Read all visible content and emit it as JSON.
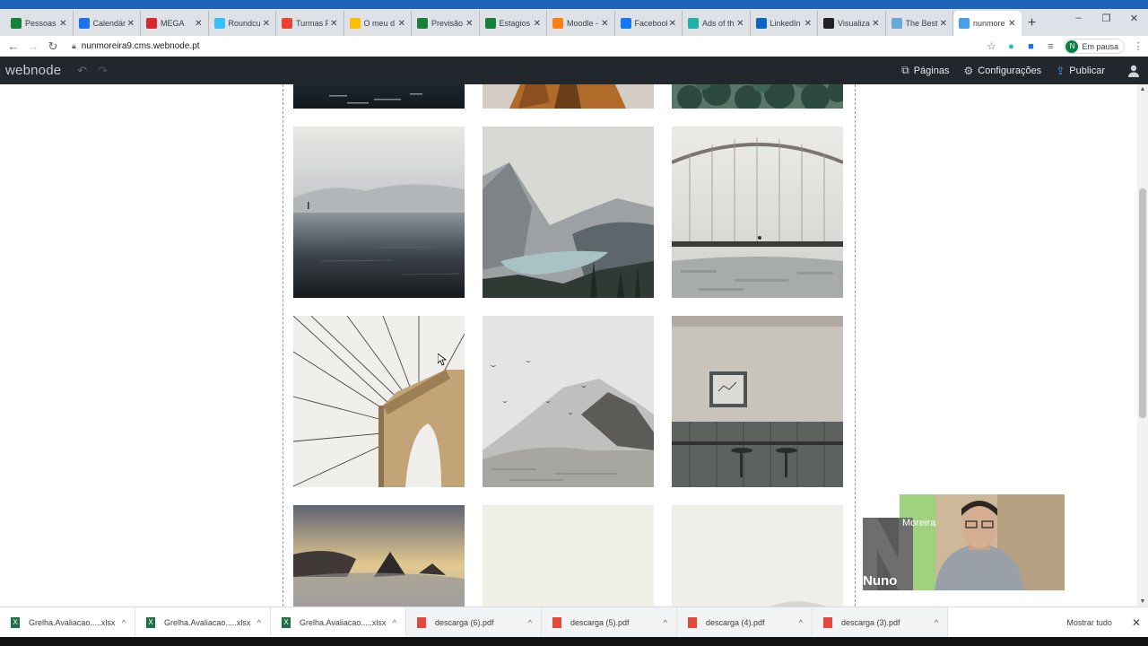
{
  "browser": {
    "tabs": [
      {
        "label": "Pessoas -",
        "icon": "google-sheets-icon",
        "color": "#188038"
      },
      {
        "label": "Calendário",
        "icon": "calendar-icon",
        "color": "#1a73e8"
      },
      {
        "label": "MEGA",
        "icon": "mega-icon",
        "color": "#d9272e"
      },
      {
        "label": "Roundcube",
        "icon": "roundcube-icon",
        "color": "#37beff"
      },
      {
        "label": "Turmas P",
        "icon": "gmail-icon",
        "color": "#ea4335"
      },
      {
        "label": "O meu d",
        "icon": "google-drive-icon",
        "color": "#fbbc04"
      },
      {
        "label": "Previsão",
        "icon": "google-sheets-icon",
        "color": "#188038"
      },
      {
        "label": "Estagios",
        "icon": "google-sheets-icon",
        "color": "#188038"
      },
      {
        "label": "Moodle -",
        "icon": "moodle-icon",
        "color": "#f98012"
      },
      {
        "label": "Facebook",
        "icon": "facebook-icon",
        "color": "#1877f2"
      },
      {
        "label": "Ads of th",
        "icon": "ads-icon",
        "color": "#20b2aa"
      },
      {
        "label": "LinkedIn",
        "icon": "linkedin-icon",
        "color": "#0a66c2"
      },
      {
        "label": "Visualiza",
        "icon": "visualize-icon",
        "color": "#202124"
      },
      {
        "label": "The Best",
        "icon": "chart-icon",
        "color": "#6aa8d8"
      },
      {
        "label": "nunmore",
        "icon": "webnode-icon",
        "color": "#4a9fe8",
        "active": true
      }
    ],
    "new_tab": "+",
    "window_controls": [
      "–",
      "❐",
      "✕"
    ],
    "url": "nunmoreira9.cms.webnode.pt",
    "profile_initial": "N",
    "profile_status": "Em pausa"
  },
  "webnode": {
    "logo": "webnode",
    "undo": "↶",
    "redo": "↷",
    "pages_label": "Páginas",
    "settings_label": "Configurações",
    "publish_label": "Publicar"
  },
  "webcam": {
    "name_top": "Moreira",
    "name_bottom": "Nuno",
    "letter": "N"
  },
  "downloads": {
    "items": [
      {
        "name": "Grelha.Avaliacao.....xlsx",
        "type": "xlsx"
      },
      {
        "name": "Grelha.Avaliacao.....xlsx",
        "type": "xlsx"
      },
      {
        "name": "Grelha.Avaliacao.....xlsx",
        "type": "xlsx"
      },
      {
        "name": "descarga (6).pdf",
        "type": "pdf"
      },
      {
        "name": "descarga (5).pdf",
        "type": "pdf"
      },
      {
        "name": "descarga (4).pdf",
        "type": "pdf"
      },
      {
        "name": "descarga (3).pdf",
        "type": "pdf"
      }
    ],
    "show_all": "Mostrar tudo"
  },
  "gallery": {
    "photos": [
      {
        "subject": "water-waves"
      },
      {
        "subject": "person-brown-jacket"
      },
      {
        "subject": "forest"
      },
      {
        "subject": "misty-lake-boat"
      },
      {
        "subject": "mountain-lake"
      },
      {
        "subject": "bridge-arch"
      },
      {
        "subject": "suspension-bridge-cables"
      },
      {
        "subject": "snowy-mountain-birds"
      },
      {
        "subject": "interior-picture-frame"
      },
      {
        "subject": "rocky-coast-sunset"
      },
      {
        "subject": "pale-fog"
      },
      {
        "subject": "pale-fog-hill"
      }
    ]
  }
}
